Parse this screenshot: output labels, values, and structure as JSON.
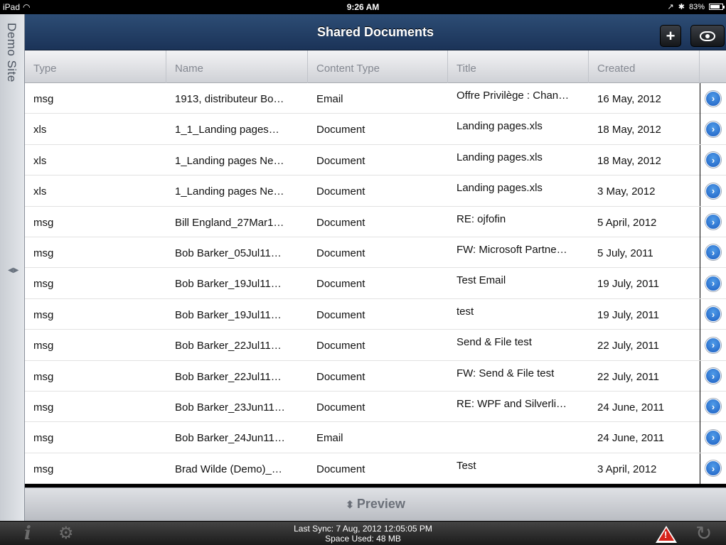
{
  "status": {
    "device": "iPad",
    "time": "9:26 AM",
    "battery": "83%",
    "battery_level": 0.83
  },
  "side": {
    "label": "Demo Site"
  },
  "header": {
    "title": "Shared Documents",
    "add_label": "+"
  },
  "table": {
    "columns": [
      "Type",
      "Name",
      "Content Type",
      "Title",
      "Created"
    ],
    "rows": [
      {
        "type": "msg",
        "name": "1913, distributeur Bo…",
        "ctype": "Email",
        "title": "Offre Privilège : Chan…",
        "created": "16 May, 2012"
      },
      {
        "type": "xls",
        "name": "1_1_Landing pages…",
        "ctype": "Document",
        "title": "Landing pages.xls",
        "created": "18 May, 2012"
      },
      {
        "type": "xls",
        "name": "1_Landing pages Ne…",
        "ctype": "Document",
        "title": "Landing pages.xls",
        "created": "18 May, 2012"
      },
      {
        "type": "xls",
        "name": "1_Landing pages Ne…",
        "ctype": "Document",
        "title": "Landing pages.xls",
        "created": "3 May, 2012"
      },
      {
        "type": "msg",
        "name": "Bill England_27Mar1…",
        "ctype": "Document",
        "title": "RE: ojfofin",
        "created": "5 April, 2012"
      },
      {
        "type": "msg",
        "name": "Bob Barker_05Jul11…",
        "ctype": "Document",
        "title": "FW: Microsoft Partne…",
        "created": "5 July, 2011"
      },
      {
        "type": "msg",
        "name": "Bob Barker_19Jul11…",
        "ctype": "Document",
        "title": "Test Email",
        "created": "19 July, 2011"
      },
      {
        "type": "msg",
        "name": "Bob Barker_19Jul11…",
        "ctype": "Document",
        "title": "test",
        "created": "19 July, 2011"
      },
      {
        "type": "msg",
        "name": "Bob Barker_22Jul11…",
        "ctype": "Document",
        "title": "Send & File test",
        "created": "22 July, 2011"
      },
      {
        "type": "msg",
        "name": "Bob Barker_22Jul11…",
        "ctype": "Document",
        "title": "FW: Send & File test",
        "created": "22 July, 2011"
      },
      {
        "type": "msg",
        "name": "Bob Barker_23Jun11…",
        "ctype": "Document",
        "title": "RE: WPF and Silverli…",
        "created": "24 June, 2011"
      },
      {
        "type": "msg",
        "name": "Bob Barker_24Jun11…",
        "ctype": "Email",
        "title": "",
        "created": "24 June, 2011"
      },
      {
        "type": "msg",
        "name": "Brad Wilde (Demo)_…",
        "ctype": "Document",
        "title": "Test",
        "created": "3 April, 2012"
      }
    ]
  },
  "preview": {
    "label": "Preview"
  },
  "footer": {
    "sync_text": "Last Sync: 7 Aug, 2012 12:05:05 PM",
    "space_text": "Space Used: 48 MB"
  }
}
